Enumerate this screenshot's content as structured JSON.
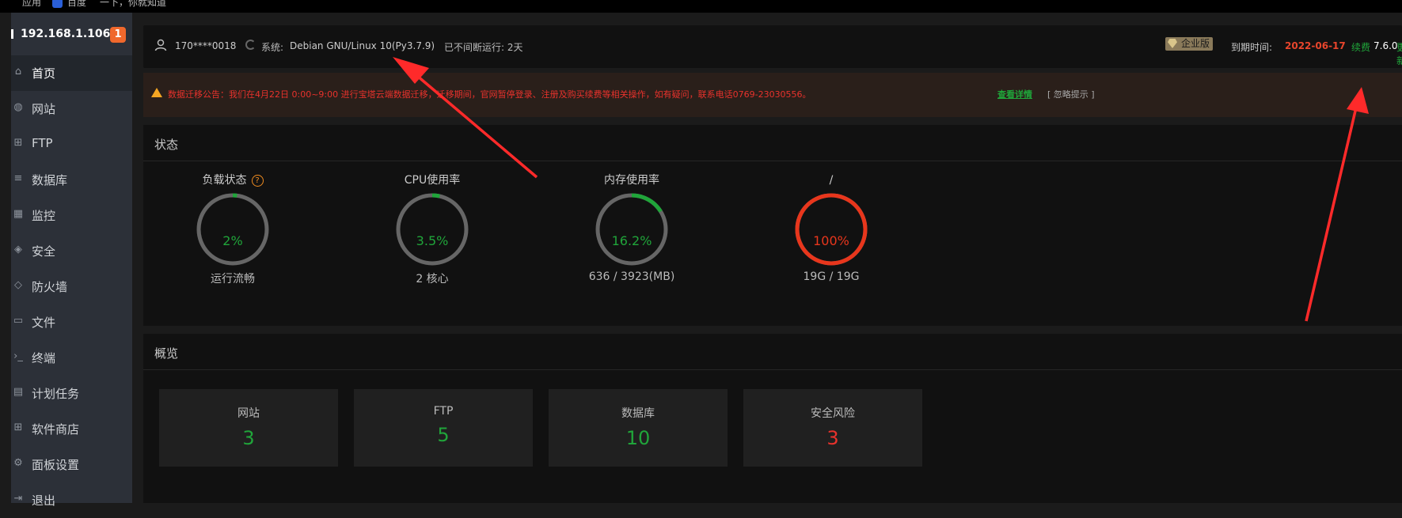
{
  "bookmarks": {
    "apps": "应用",
    "baidu": "百度",
    "search": "一下，你就知道"
  },
  "sidebar": {
    "ip": "192.168.1.106",
    "badge": "1",
    "items": [
      {
        "label": "首页",
        "icon": "home-icon"
      },
      {
        "label": "网站",
        "icon": "globe-icon"
      },
      {
        "label": "FTP",
        "icon": "server-icon"
      },
      {
        "label": "数据库",
        "icon": "database-icon"
      },
      {
        "label": "监控",
        "icon": "chart-icon"
      },
      {
        "label": "安全",
        "icon": "shield-icon"
      },
      {
        "label": "防火墙",
        "icon": "firewall-icon"
      },
      {
        "label": "文件",
        "icon": "folder-icon"
      },
      {
        "label": "终端",
        "icon": "terminal-icon"
      },
      {
        "label": "计划任务",
        "icon": "calendar-icon"
      },
      {
        "label": "软件商店",
        "icon": "grid-icon"
      },
      {
        "label": "面板设置",
        "icon": "gear-icon"
      },
      {
        "label": "退出",
        "icon": "logout-icon"
      }
    ]
  },
  "header": {
    "user": "170****0018",
    "sys_label": "系统:",
    "sys_value": "Debian GNU/Linux 10(Py3.7.9)",
    "uptime": "已不间断运行: 2天",
    "edition": "企业版",
    "expire_label": "到期时间:",
    "expire_date": "2022-06-17",
    "renew": "续费",
    "version": "7.6.0",
    "update": "更新"
  },
  "notice": {
    "text": "数据迁移公告：我们在4月22日 0:00~9:00 进行宝塔云端数据迁移，迁移期间，官网暂停登录、注册及购买续费等相关操作，如有疑问，联系电话0769-23030556。",
    "detail": "查看详情",
    "ignore": "[ 忽略提示 ]"
  },
  "status": {
    "title": "状态",
    "gauges": [
      {
        "title": "负载状态",
        "percent_text": "2%",
        "value": 2,
        "sub": "运行流畅",
        "help": "?",
        "color": "#20a53a"
      },
      {
        "title": "CPU使用率",
        "percent_text": "3.5%",
        "value": 3.5,
        "sub": "2 核心",
        "color": "#20a53a"
      },
      {
        "title": "内存使用率",
        "percent_text": "16.2%",
        "value": 16.2,
        "sub": "636 / 3923(MB)",
        "color": "#20a53a"
      },
      {
        "title": "/",
        "percent_text": "100%",
        "value": 100,
        "sub": "19G / 19G",
        "color": "#e8361c"
      }
    ]
  },
  "overview": {
    "title": "概览",
    "cards": [
      {
        "label": "网站",
        "value": "3"
      },
      {
        "label": "FTP",
        "value": "5"
      },
      {
        "label": "数据库",
        "value": "10"
      },
      {
        "label": "安全风险",
        "value": "3"
      }
    ]
  },
  "colors": {
    "accent_green": "#20a53a",
    "alert_red": "#e8322c",
    "annotation_red": "#ff2a2a"
  }
}
